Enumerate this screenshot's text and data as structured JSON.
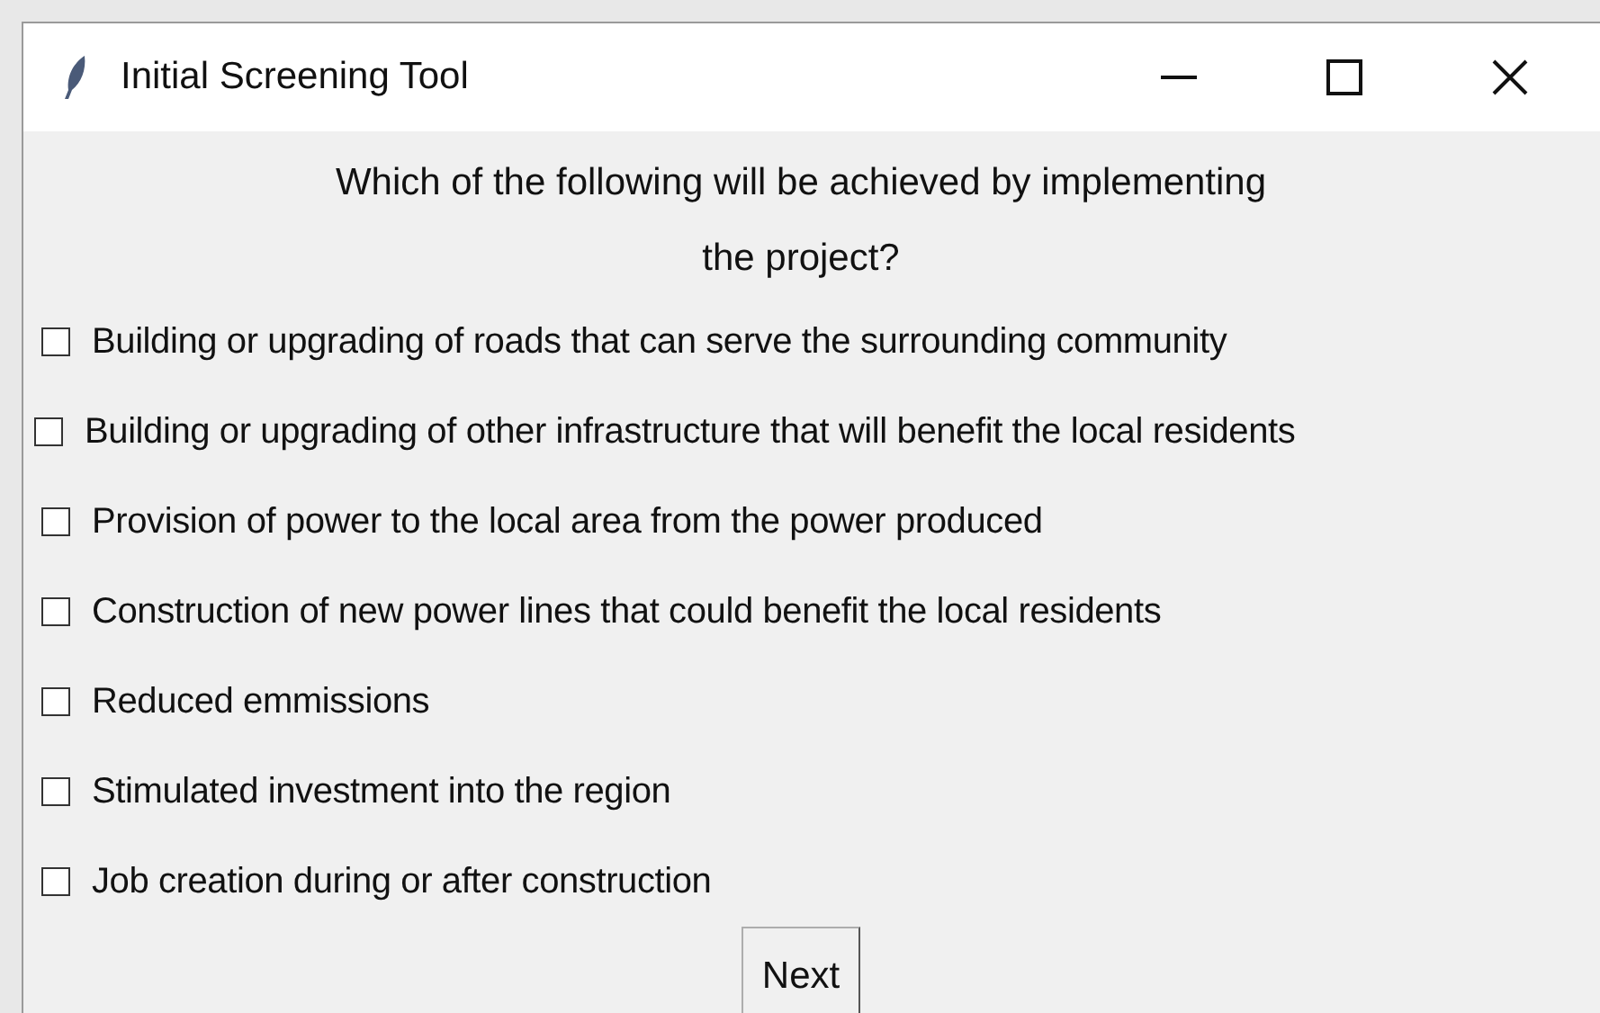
{
  "window": {
    "title": "Initial Screening Tool"
  },
  "question": [
    "Which of the following will be achieved by implementing",
    "the project?"
  ],
  "options": [
    {
      "label": "Building or upgrading of roads that can serve the surrounding community",
      "checked": false
    },
    {
      "label": "Building or upgrading of other infrastructure that will benefit the local residents",
      "checked": false
    },
    {
      "label": "Provision of power to the local area from the power produced",
      "checked": false
    },
    {
      "label": "Construction of new power lines that could benefit the local residents",
      "checked": false
    },
    {
      "label": "Reduced emmissions",
      "checked": false
    },
    {
      "label": "Stimulated investment into the region",
      "checked": false
    },
    {
      "label": "Job creation during or after construction",
      "checked": false
    }
  ],
  "buttons": [
    "Next"
  ]
}
